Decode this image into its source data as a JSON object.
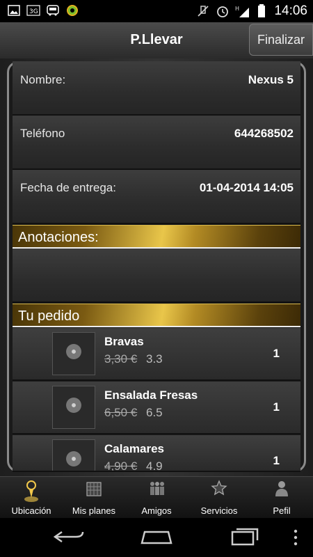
{
  "status_bar": {
    "time": "14:06",
    "icons": [
      "image-icon",
      "3g-icon",
      "bus-icon",
      "settings-gear-icon",
      "mute-icon",
      "alarm-icon",
      "signal-icon",
      "battery-icon"
    ]
  },
  "action_bar": {
    "title": "P.Llevar",
    "finalize_label": "Finalizar"
  },
  "form": {
    "name_label": "Nombre:",
    "name_value": "Nexus 5",
    "phone_label": "Teléfono",
    "phone_value": "644268502",
    "delivery_label": "Fecha de entrega:",
    "delivery_value": "01-04-2014 14:05"
  },
  "notes": {
    "header": "Anotaciones:",
    "value": ""
  },
  "order": {
    "header": "Tu pedido",
    "items": [
      {
        "name": "Bravas",
        "old_price": "3,30 €",
        "price": "3.3",
        "qty": "1"
      },
      {
        "name": "Ensalada Fresas",
        "old_price": "6,50 €",
        "price": "6.5",
        "qty": "1"
      },
      {
        "name": "Calamares",
        "old_price": "4,90 €",
        "price": "4.9",
        "qty": "1"
      }
    ]
  },
  "bottom_nav": {
    "tabs": [
      {
        "label": "Ubicación",
        "icon": "golf-tee-icon",
        "active": true
      },
      {
        "label": "Mis planes",
        "icon": "calendar-icon",
        "active": false
      },
      {
        "label": "Amigos",
        "icon": "people-icon",
        "active": false
      },
      {
        "label": "Servicios",
        "icon": "star-icon",
        "active": false
      },
      {
        "label": "Pefil",
        "icon": "profile-icon",
        "active": false
      }
    ]
  },
  "colors": {
    "gold_accent": "#e9c64a",
    "background": "#1a1a1a",
    "active_glow": "#f3c94b"
  }
}
